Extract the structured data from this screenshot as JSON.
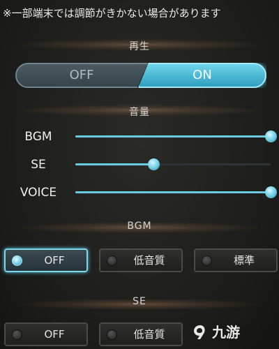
{
  "notice": "※一部端末では調節がきかない場合があります",
  "playback": {
    "title": "再生",
    "off_label": "OFF",
    "on_label": "ON",
    "selected": "ON"
  },
  "volume": {
    "title": "音量",
    "sliders": [
      {
        "label": "BGM",
        "level": 1.0
      },
      {
        "label": "SE",
        "level": 0.4
      },
      {
        "label": "VOICE",
        "level": 1.0
      }
    ]
  },
  "bgm_quality": {
    "title": "BGM",
    "options": [
      "OFF",
      "低音質",
      "標準"
    ],
    "selected": "OFF"
  },
  "se_quality": {
    "title": "SE",
    "options": [
      "OFF",
      "低音質"
    ],
    "selected": null
  },
  "watermark": "九游",
  "colors": {
    "accent": "#6fd4ea",
    "background": "#1d1d1b"
  }
}
